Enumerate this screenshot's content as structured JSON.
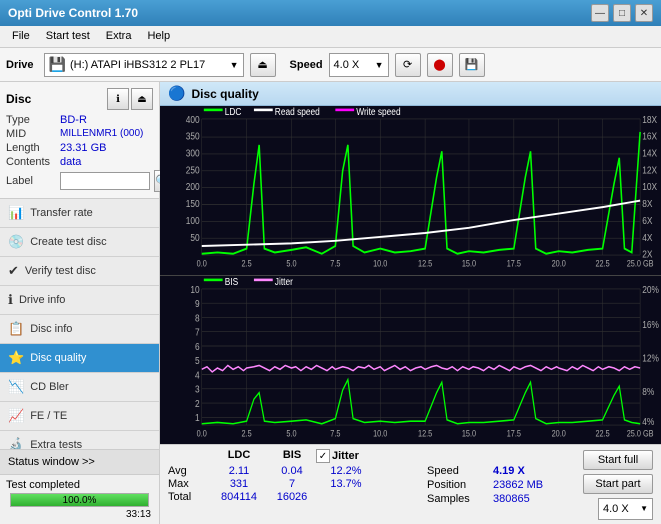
{
  "app": {
    "title": "Opti Drive Control 1.70",
    "title_icon": "💿"
  },
  "title_bar": {
    "minimize": "—",
    "maximize": "□",
    "close": "✕"
  },
  "menu": {
    "items": [
      "File",
      "Start test",
      "Extra",
      "Help"
    ]
  },
  "toolbar": {
    "drive_label": "Drive",
    "drive_icon": "💾",
    "drive_value": "(H:) ATAPI iHBS312  2 PL17",
    "eject_icon": "⏏",
    "speed_label": "Speed",
    "speed_value": "4.0 X",
    "btn1": "⟳",
    "btn2": "🔴",
    "btn3": "💾"
  },
  "disc": {
    "label": "Disc",
    "type_key": "Type",
    "type_val": "BD-R",
    "mid_key": "MID",
    "mid_val": "MILLENMR1 (000)",
    "length_key": "Length",
    "length_val": "23.31 GB",
    "contents_key": "Contents",
    "contents_val": "data",
    "label_key": "Label",
    "label_val": ""
  },
  "nav": {
    "items": [
      {
        "id": "transfer-rate",
        "icon": "📊",
        "label": "Transfer rate",
        "active": false
      },
      {
        "id": "create-test-disc",
        "icon": "💿",
        "label": "Create test disc",
        "active": false
      },
      {
        "id": "verify-test-disc",
        "icon": "✔",
        "label": "Verify test disc",
        "active": false
      },
      {
        "id": "drive-info",
        "icon": "ℹ",
        "label": "Drive info",
        "active": false
      },
      {
        "id": "disc-info",
        "icon": "📋",
        "label": "Disc info",
        "active": false
      },
      {
        "id": "disc-quality",
        "icon": "⭐",
        "label": "Disc quality",
        "active": true
      },
      {
        "id": "cd-bler",
        "icon": "📉",
        "label": "CD Bler",
        "active": false
      },
      {
        "id": "fe-te",
        "icon": "📈",
        "label": "FE / TE",
        "active": false
      },
      {
        "id": "extra-tests",
        "icon": "🔬",
        "label": "Extra tests",
        "active": false
      }
    ]
  },
  "status": {
    "window_label": "Status window >>",
    "completed_label": "Test completed",
    "progress": 100,
    "progress_text": "100.0%",
    "time": "33:13"
  },
  "quality": {
    "title": "Disc quality",
    "legend_top": [
      {
        "label": "LDC",
        "color": "#00ff00"
      },
      {
        "label": "Read speed",
        "color": "#ffffff"
      },
      {
        "label": "Write speed",
        "color": "#ff00ff"
      }
    ],
    "legend_bottom": [
      {
        "label": "BIS",
        "color": "#00ff00"
      },
      {
        "label": "Jitter",
        "color": "#ff88ff"
      }
    ],
    "top_chart": {
      "y_max": 400,
      "y_labels_left": [
        "400",
        "350",
        "300",
        "250",
        "200",
        "150",
        "100",
        "50"
      ],
      "y_labels_right": [
        "18X",
        "16X",
        "14X",
        "12X",
        "10X",
        "8X",
        "6X",
        "4X",
        "2X"
      ],
      "x_labels": [
        "0.0",
        "2.5",
        "5.0",
        "7.5",
        "10.0",
        "12.5",
        "15.0",
        "17.5",
        "20.0",
        "22.5",
        "25.0 GB"
      ]
    },
    "bottom_chart": {
      "y_max": 10,
      "y_labels_left": [
        "10",
        "9",
        "8",
        "7",
        "6",
        "5",
        "4",
        "3",
        "2",
        "1"
      ],
      "y_labels_right": [
        "20%",
        "16%",
        "12%",
        "8%",
        "4%"
      ],
      "x_labels": [
        "0.0",
        "2.5",
        "5.0",
        "7.5",
        "10.0",
        "12.5",
        "15.0",
        "17.5",
        "20.0",
        "22.5",
        "25.0 GB"
      ]
    }
  },
  "stats": {
    "ldc_label": "LDC",
    "bis_label": "BIS",
    "jitter_label": "Jitter",
    "jitter_checked": true,
    "speed_label": "Speed",
    "speed_val": "4.19 X",
    "speed_dropdown": "4.0 X",
    "rows": [
      {
        "label": "Avg",
        "ldc": "2.11",
        "bis": "0.04",
        "jitter": "12.2%"
      },
      {
        "label": "Max",
        "ldc": "331",
        "bis": "7",
        "jitter": "13.7%"
      },
      {
        "label": "Total",
        "ldc": "804114",
        "bis": "16026",
        "jitter": ""
      }
    ],
    "position_key": "Position",
    "position_val": "23862 MB",
    "samples_key": "Samples",
    "samples_val": "380865",
    "btn_start_full": "Start full",
    "btn_start_part": "Start part"
  }
}
